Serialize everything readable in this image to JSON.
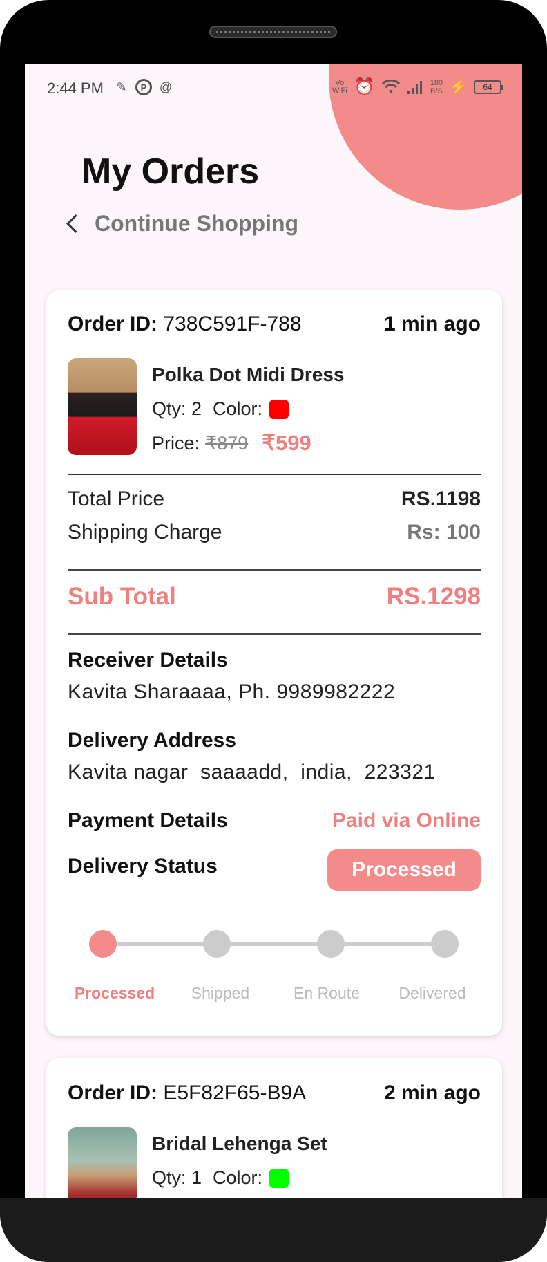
{
  "status_bar": {
    "time": "2:44 PM",
    "vo": "Vo",
    "wifi_label": "WiFi",
    "speed_value": "180",
    "speed_unit": "B/S",
    "battery": "64"
  },
  "header": {
    "title": "My Orders",
    "back_label": "Continue Shopping"
  },
  "orders": [
    {
      "order_id_label": "Order ID:",
      "order_id": "738C591F-788",
      "time_ago": "1 min ago",
      "product": {
        "name": "Polka Dot Midi Dress",
        "qty_label": "Qty: 2",
        "color_label": "Color:",
        "color": "#ff0000",
        "price_label": "Price:",
        "original_price": "₹879",
        "price": "₹599"
      },
      "total_price_label": "Total Price",
      "total_price": "RS.1198",
      "shipping_label": "Shipping Charge",
      "shipping": "Rs: 100",
      "subtotal_label": "Sub Total",
      "subtotal": "RS.1298",
      "receiver_label": "Receiver Details",
      "receiver": "Kavita Sharaaaa, Ph. 9989982222",
      "address_label": "Delivery Address",
      "address": "Kavita nagar  saaaadd,  india,  223321",
      "payment_label": "Payment Details",
      "payment": "Paid via Online",
      "delivery_status_label": "Delivery Status",
      "delivery_status": "Processed",
      "steps": [
        "Processed",
        "Shipped",
        "En Route",
        "Delivered"
      ],
      "active_step": 0
    },
    {
      "order_id_label": "Order ID:",
      "order_id": "E5F82F65-B9A",
      "time_ago": "2 min ago",
      "product": {
        "name": "Bridal Lehenga Set",
        "qty_label": "Qty: 1",
        "color_label": "Color:",
        "color": "#00ff00"
      }
    }
  ],
  "colors": {
    "accent": "#f48b8b",
    "accent_text": "#f07f7f",
    "background": "#fdf7fb"
  }
}
